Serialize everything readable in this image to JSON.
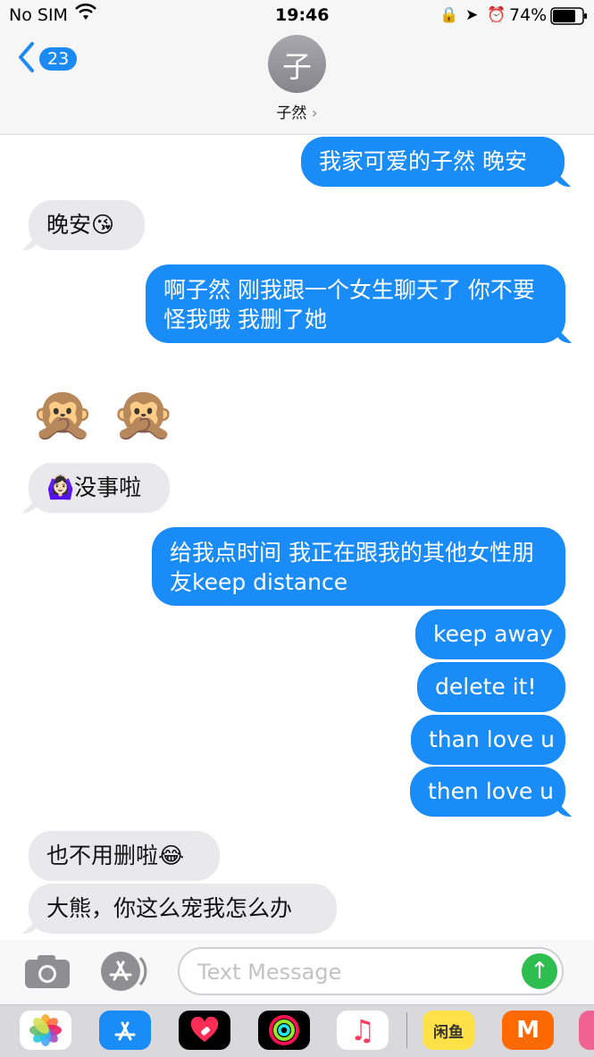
{
  "status": {
    "carrier": "No SIM",
    "time": "19:46",
    "battery": "74%"
  },
  "nav": {
    "back_count": "23",
    "avatar_letter": "子",
    "contact_name": "子然",
    "chevron": "›"
  },
  "messages": [
    {
      "dir": "out",
      "text": "我家可爱的子然 晚安"
    },
    {
      "dir": "in",
      "text": "晚安😘"
    },
    {
      "dir": "out",
      "text": "啊子然 刚我跟一个女生聊天了 你不要怪我哦 我删了她"
    },
    {
      "dir": "in",
      "text": "🙊 🙊"
    },
    {
      "dir": "in",
      "text": "🙆🏻‍♀️没事啦"
    },
    {
      "dir": "out",
      "text": "给我点时间 我正在跟我的其他女性朋友keep distance"
    },
    {
      "dir": "out",
      "text": "keep away"
    },
    {
      "dir": "out",
      "text": "delete it!"
    },
    {
      "dir": "out",
      "text": "than love u"
    },
    {
      "dir": "out",
      "text": "then love u"
    },
    {
      "dir": "in",
      "text": "也不用删啦😂"
    },
    {
      "dir": "in",
      "text": "大熊，你这么宠我怎么办"
    }
  ],
  "composer": {
    "placeholder": "Text Message"
  },
  "dock": {
    "icons": [
      "photos-icon",
      "app-store-icon",
      "heart-app-icon",
      "activity-icon",
      "music-icon",
      "xianyu-app-icon",
      "mango-tv-icon",
      "more-app-icon"
    ],
    "xianyu": "闲鱼",
    "mango": "M"
  },
  "colors": {
    "outgoing": "#1a8cf7",
    "incoming": "#e9e9eb",
    "send": "#2ebd4f",
    "accent": "#1b8af2"
  }
}
